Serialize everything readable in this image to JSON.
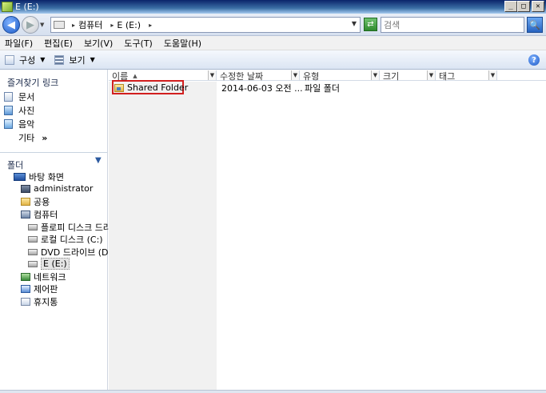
{
  "window": {
    "title": "E (E:)"
  },
  "address": {
    "crumbs": [
      "컴퓨터",
      "E (E:)"
    ]
  },
  "search": {
    "placeholder": "검색"
  },
  "menu": [
    "파일(F)",
    "편집(E)",
    "보기(V)",
    "도구(T)",
    "도움말(H)"
  ],
  "toolbar": {
    "organize": "구성",
    "views": "보기"
  },
  "favorites": {
    "title": "즐겨찾기 링크",
    "items": [
      "문서",
      "사진",
      "음악"
    ],
    "more": "기타",
    "more_glyph": "»"
  },
  "folders": {
    "title": "폴더",
    "tree": [
      {
        "label": "바탕 화면",
        "icon": "desktop-icon"
      },
      {
        "label": "administrator",
        "icon": "user-folder-icon"
      },
      {
        "label": "공용",
        "icon": "folder-icon"
      },
      {
        "label": "컴퓨터",
        "icon": "computer-icon"
      },
      {
        "label": "플로피 디스크 드라이브 (A:)",
        "icon": "floppy-drive-icon"
      },
      {
        "label": "로컬 디스크 (C:)",
        "icon": "local-disk-icon"
      },
      {
        "label": "DVD 드라이브 (D:)",
        "icon": "dvd-drive-icon"
      },
      {
        "label": "E (E:)",
        "icon": "drive-icon"
      },
      {
        "label": "네트워크",
        "icon": "network-icon"
      },
      {
        "label": "제어판",
        "icon": "control-panel-icon"
      },
      {
        "label": "휴지통",
        "icon": "recycle-bin-icon"
      }
    ]
  },
  "columns": [
    "이름",
    "수정한 날짜",
    "유형",
    "크기",
    "태그"
  ],
  "files": [
    {
      "name": "Shared Folder",
      "modified": "2014-06-03 오전 ...",
      "type": "파일 폴더",
      "size": "",
      "tags": ""
    }
  ],
  "colors": {
    "highlight": "#d21f1f",
    "titlebar": "#0a246a"
  }
}
